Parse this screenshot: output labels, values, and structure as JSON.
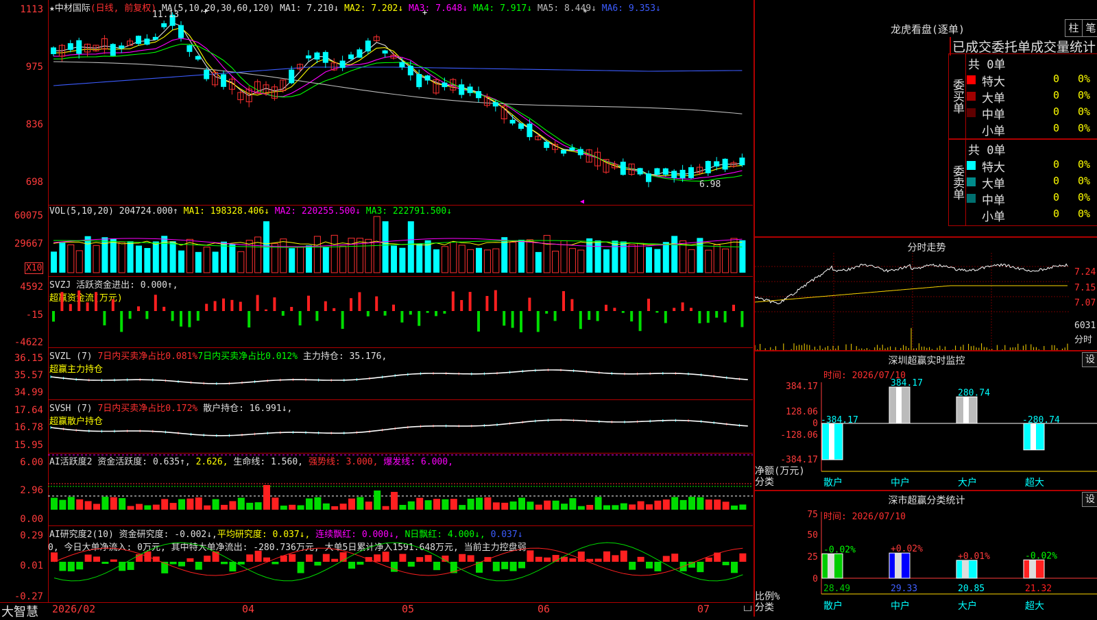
{
  "title_bar": {
    "stock_name": "★中材国际",
    "period": "(日线, 前复权)",
    "ma_label": "MA(5,10,20,30,60,120)",
    "ma_values": [
      {
        "text": "MA1: 7.210↓",
        "color": "#e0e0e0"
      },
      {
        "text": "MA2: 7.202↓",
        "color": "#ffff00"
      },
      {
        "text": "MA3: 7.648↓",
        "color": "#ff00ff"
      },
      {
        "text": "MA4: 7.917↓",
        "color": "#00ff00"
      },
      {
        "text": "MA5: 8.449↓",
        "color": "#bbbbbb"
      },
      {
        "text": "MA6: 9.353↓",
        "color": "#3c5cff"
      }
    ]
  },
  "price_pane": {
    "y_ticks": [
      "1113",
      "975",
      "836",
      "698"
    ],
    "high_label": "11.13",
    "low_label": "6.98"
  },
  "vol_pane": {
    "header": "VOL(5,10,20)",
    "vol": "204724.000↑",
    "ma1": "MA1: 198328.406↓",
    "ma2": "MA2: 220255.500↓",
    "ma3": "MA3: 222791.500↓",
    "y_ticks": [
      "60075",
      "29667"
    ],
    "unit": "X10"
  },
  "svzj_pane": {
    "line1": "SVZJ  活跃资金进出: 0.000↑,",
    "line2": "超赢资金流(万元)",
    "y_ticks": [
      "4592",
      "-15",
      "-4622"
    ]
  },
  "svzl_pane": {
    "prefix": "SVZL (7)",
    "red_text": "7日内买卖净占比0.081%",
    "green_text": "7日内买卖净占比0.012%",
    "white_text": "主力持仓: 35.176,",
    "line2": "超赢主力持仓",
    "y_ticks": [
      "36.15",
      "35.57",
      "34.99"
    ]
  },
  "svsh_pane": {
    "prefix": "SVSH (7)",
    "red_text": "7日内买卖净占比0.172%",
    "white_text": "散户持仓: 16.991↓,",
    "line2": "超赢散户持仓",
    "y_ticks": [
      "17.64",
      "16.78",
      "15.95"
    ]
  },
  "ai_active_pane": {
    "prefix": "AI活跃度2 资金活跃度: 0.635↑,",
    "yellow": "2.626,",
    "white": "生命线: 1.560,",
    "red": "强势线: 3.000,",
    "magenta": "爆发线: 6.000,",
    "y_ticks": [
      "6.00",
      "2.96",
      "0.00"
    ]
  },
  "ai_research_pane": {
    "prefix": "AI研究度2(10) 资金研究度: -0.002↓,",
    "yellow": "平均研究度: 0.037↓,",
    "magenta": "连续飘红: 0.000↓,",
    "green": "N日飘红: 4.000↓,",
    "blue": "0.037↓",
    "line2": "0, 今日大单净流入: 0万元, 其中特大单净流出: -280.736万元, 大单5日累计净入1591.648万元, 当前主力控盘弱",
    "y_ticks": [
      "0.29",
      "0.01",
      "-0.27"
    ]
  },
  "x_axis": {
    "labels": [
      "2026/02",
      "04",
      "05",
      "06",
      "07"
    ],
    "brand": "大智慧"
  },
  "dragon_tiger": {
    "title": "龙虎看盘(逐单)",
    "btn1": "柱",
    "btn2": "笔",
    "subtitle": "已成交委托单成交量统计",
    "buy": {
      "side_label": "委买单",
      "total": "共 0单",
      "rows": [
        {
          "name": "特大",
          "value": "0",
          "pct": "0%",
          "color": "#ff0000"
        },
        {
          "name": "大单",
          "value": "0",
          "pct": "0%",
          "color": "#a00000"
        },
        {
          "name": "中单",
          "value": "0",
          "pct": "0%",
          "color": "#600000"
        },
        {
          "name": "小单",
          "value": "0",
          "pct": "0%",
          "color": "#000000"
        }
      ]
    },
    "sell": {
      "side_label": "委卖单",
      "total": "共 0单",
      "rows": [
        {
          "name": "特大",
          "value": "0",
          "pct": "0%",
          "color": "#00ffff"
        },
        {
          "name": "大单",
          "value": "0",
          "pct": "0%",
          "color": "#008b8b"
        },
        {
          "name": "中单",
          "value": "0",
          "pct": "0%",
          "color": "#007070"
        },
        {
          "name": "小单",
          "value": "0",
          "pct": "0%",
          "color": "#000000"
        }
      ]
    }
  },
  "intraday": {
    "title": "分时走势",
    "y_ticks": [
      "7.24",
      "7.15",
      "7.07"
    ],
    "vol_label": "6031",
    "vol_unit": "分时"
  },
  "monitor": {
    "title": "深圳超赢实时监控",
    "settings_btn": "设",
    "time": "时间: 2026/07/10",
    "y_ticks": [
      "384.17",
      "128.06",
      "0",
      "-128.06",
      "-384.17"
    ],
    "y_title": "净额(万元)",
    "x_title": "分类",
    "categories": [
      "散户",
      "中户",
      "大户",
      "超大"
    ],
    "bar_labels": [
      "-384.17",
      "384.17",
      "280.74",
      "-280.74"
    ]
  },
  "classify": {
    "title": "深市超赢分类统计",
    "settings_btn": "设",
    "time": "时间: 2026/07/10",
    "y_ticks": [
      "75",
      "50",
      "25",
      "0"
    ],
    "y_title": "比例%",
    "x_title": "分类",
    "categories": [
      "散户",
      "中户",
      "大户",
      "超大"
    ],
    "top_labels": [
      "-0.02%",
      "+0.02%",
      "+0.01%",
      "-0.02%"
    ],
    "bottom_labels": [
      "28.49",
      "29.33",
      "20.85",
      "21.32"
    ]
  }
}
